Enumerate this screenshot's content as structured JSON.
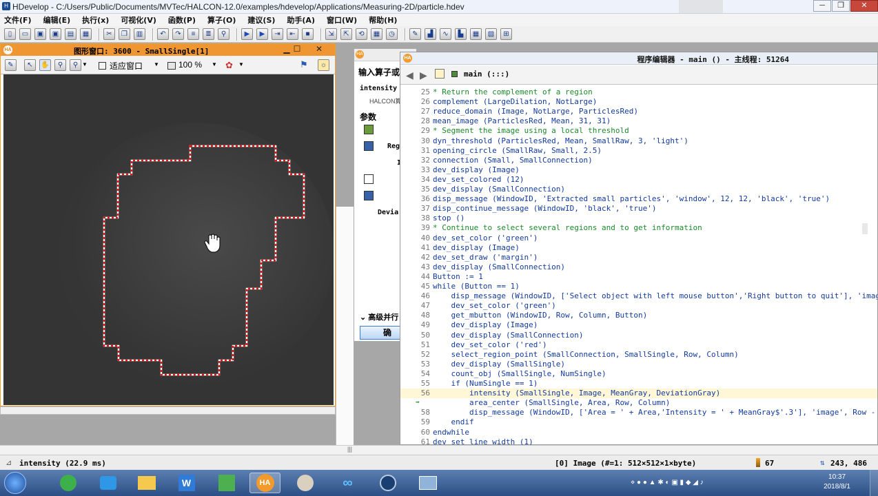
{
  "window": {
    "title": "HDevelop - C:/Users/Public/Documents/MVTec/HALCON-12.0/examples/hdevelop/Applications/Measuring-2D/particle.hdev",
    "minimize": "─",
    "restore": "❐",
    "close": "✕"
  },
  "menu": [
    "文件(F)",
    "编辑(E)",
    "执行(x)",
    "可视化(V)",
    "函数(P)",
    "算子(O)",
    "建议(S)",
    "助手(A)",
    "窗口(W)",
    "帮助(H)"
  ],
  "graphics_window": {
    "title": "图形窗口: 3600 - SmallSingle[1]",
    "fit_label": "适应窗口",
    "zoom": "100 %"
  },
  "operator_panel": {
    "header": "输入算子或",
    "operator": "intensity",
    "sub": "HALCON算",
    "params_label": "参数",
    "param1": "Reg",
    "param2": "I",
    "param3": "Devia",
    "advanced": "高级并行",
    "ok": "确"
  },
  "editor": {
    "title": "程序编辑器 - main () - 主线程: 51264",
    "procedure": "main (:::)",
    "lines": [
      {
        "n": "25",
        "t": "* Return the complement of a region",
        "c": "cm"
      },
      {
        "n": "26",
        "t": "complement (LargeDilation, NotLarge)",
        "c": "kw"
      },
      {
        "n": "27",
        "t": "reduce_domain (Image, NotLarge, ParticlesRed)",
        "c": "kw"
      },
      {
        "n": "28",
        "t": "mean_image (ParticlesRed, Mean, 31, 31)",
        "c": "kw"
      },
      {
        "n": "29",
        "t": "* Segment the image using a local threshold",
        "c": "cm"
      },
      {
        "n": "30",
        "t": "dyn_threshold (ParticlesRed, Mean, SmallRaw, 3, 'light')",
        "c": "kw"
      },
      {
        "n": "31",
        "t": "opening_circle (SmallRaw, Small, 2.5)",
        "c": "kw"
      },
      {
        "n": "32",
        "t": "connection (Small, SmallConnection)",
        "c": "kw"
      },
      {
        "n": "33",
        "t": "dev_display (Image)",
        "c": "kw"
      },
      {
        "n": "34",
        "t": "dev_set_colored (12)",
        "c": "kw"
      },
      {
        "n": "35",
        "t": "dev_display (SmallConnection)",
        "c": "kw"
      },
      {
        "n": "36",
        "t": "disp_message (WindowID, 'Extracted small particles', 'window', 12, 12, 'black', 'true')",
        "c": "kw"
      },
      {
        "n": "37",
        "t": "disp_continue_message (WindowID, 'black', 'true')",
        "c": "kw"
      },
      {
        "n": "38",
        "t": "stop ()",
        "c": "kw"
      },
      {
        "n": "39",
        "t": "* Continue to select several regions and to get information",
        "c": "cm"
      },
      {
        "n": "40",
        "t": "dev_set_color ('green')",
        "c": "kw"
      },
      {
        "n": "41",
        "t": "dev_display (Image)",
        "c": "kw"
      },
      {
        "n": "42",
        "t": "dev_set_draw ('margin')",
        "c": "kw"
      },
      {
        "n": "43",
        "t": "dev_display (SmallConnection)",
        "c": "kw"
      },
      {
        "n": "44",
        "t": "Button := 1",
        "c": "kw"
      },
      {
        "n": "45",
        "t": "while (Button == 1)",
        "c": "kw"
      },
      {
        "n": "46",
        "t": "    disp_message (WindowID, ['Select object with left mouse button','Right button to quit'], 'image'",
        "c": "kw"
      },
      {
        "n": "47",
        "t": "    dev_set_color ('green')",
        "c": "kw"
      },
      {
        "n": "48",
        "t": "    get_mbutton (WindowID, Row, Column, Button)",
        "c": "kw"
      },
      {
        "n": "49",
        "t": "    dev_display (Image)",
        "c": "kw"
      },
      {
        "n": "50",
        "t": "    dev_display (SmallConnection)",
        "c": "kw"
      },
      {
        "n": "51",
        "t": "    dev_set_color ('red')",
        "c": "kw"
      },
      {
        "n": "52",
        "t": "    select_region_point (SmallConnection, SmallSingle, Row, Column)",
        "c": "kw"
      },
      {
        "n": "53",
        "t": "    dev_display (SmallSingle)",
        "c": "kw"
      },
      {
        "n": "54",
        "t": "    count_obj (SmallSingle, NumSingle)",
        "c": "kw"
      },
      {
        "n": "55",
        "t": "    if (NumSingle == 1)",
        "c": "kw"
      },
      {
        "n": "56",
        "t": "        intensity (SmallSingle, Image, MeanGray, DeviationGray)",
        "c": "kw"
      },
      {
        "n": "57",
        "t": "        area_center (SmallSingle, Area, Row, Column)",
        "c": "kw"
      },
      {
        "n": "58",
        "t": "        disp_message (WindowID, ['Area = ' + Area,'Intensity = ' + MeanGray$'.3'], 'image', Row -",
        "c": "kw"
      },
      {
        "n": "59",
        "t": "    endif",
        "c": "kw"
      },
      {
        "n": "60",
        "t": "endwhile",
        "c": "kw"
      },
      {
        "n": "61",
        "t": "dev_set_line_width (1)",
        "c": "kw"
      }
    ]
  },
  "status": {
    "left": "intensity (22.9 ms)",
    "image": "[0] Image (#=1: 512×512×1×byte)",
    "gray": "67",
    "coords": "243, 486"
  },
  "taskbar": {
    "time": "10:37",
    "date": "2018/8/1"
  }
}
